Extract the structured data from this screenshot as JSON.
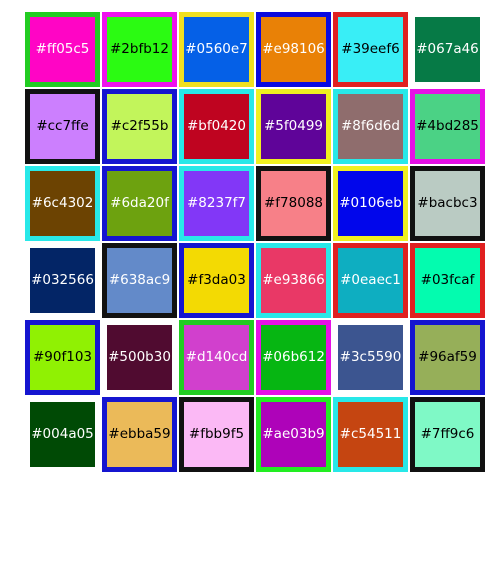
{
  "swatches": [
    {
      "label": "#ff05c5",
      "fill": "#ff05c5",
      "border": "#22cc22",
      "text_color": "#ffffff"
    },
    {
      "label": "#2bfb12",
      "fill": "#2bfb12",
      "border": "#ee11ee",
      "text_color": "#000000"
    },
    {
      "label": "#0560e7",
      "fill": "#0560e7",
      "border": "#f0e020",
      "text_color": "#ffffff"
    },
    {
      "label": "#e98106",
      "fill": "#e98106",
      "border": "#0a0ae0",
      "text_color": "#ffffff"
    },
    {
      "label": "#39eef6",
      "fill": "#39eef6",
      "border": "#e02020",
      "text_color": "#000000"
    },
    {
      "label": "#067a46",
      "fill": "#067a46",
      "border": "#ffffff",
      "text_color": "#ffffff"
    },
    {
      "label": "#cc7ffe",
      "fill": "#cc7ffe",
      "border": "#111111",
      "text_color": "#000000"
    },
    {
      "label": "#c2f55b",
      "fill": "#c2f55b",
      "border": "#1515d0",
      "text_color": "#000000"
    },
    {
      "label": "#bf0420",
      "fill": "#bf0420",
      "border": "#28e8e8",
      "text_color": "#ffffff"
    },
    {
      "label": "#5f0499",
      "fill": "#5f0499",
      "border": "#f0f020",
      "text_color": "#ffffff"
    },
    {
      "label": "#8f6d6d",
      "fill": "#8f6d6d",
      "border": "#28e8e8",
      "text_color": "#ffffff"
    },
    {
      "label": "#4bd285",
      "fill": "#4bd285",
      "border": "#e610e6",
      "text_color": "#000000"
    },
    {
      "label": "#6c4302",
      "fill": "#6c4302",
      "border": "#28e8e8",
      "text_color": "#ffffff"
    },
    {
      "label": "#6da20f",
      "fill": "#6da20f",
      "border": "#1515d0",
      "text_color": "#ffffff"
    },
    {
      "label": "#8237f7",
      "fill": "#8237f7",
      "border": "#28e8e8",
      "text_color": "#ffffff"
    },
    {
      "label": "#f78088",
      "fill": "#f78088",
      "border": "#111111",
      "text_color": "#000000"
    },
    {
      "label": "#0106eb",
      "fill": "#0106eb",
      "border": "#f0f020",
      "text_color": "#ffffff"
    },
    {
      "label": "#bacbc3",
      "fill": "#bacbc3",
      "border": "#111111",
      "text_color": "#000000"
    },
    {
      "label": "#032566",
      "fill": "#032566",
      "border": "#ffffff",
      "text_color": "#ffffff"
    },
    {
      "label": "#638ac9",
      "fill": "#638ac9",
      "border": "#111111",
      "text_color": "#ffffff"
    },
    {
      "label": "#f3da03",
      "fill": "#f3da03",
      "border": "#1515d0",
      "text_color": "#000000"
    },
    {
      "label": "#e93866",
      "fill": "#e93866",
      "border": "#28e8e8",
      "text_color": "#ffffff"
    },
    {
      "label": "#0eaec1",
      "fill": "#0eaec1",
      "border": "#e02020",
      "text_color": "#ffffff"
    },
    {
      "label": "#03fcaf",
      "fill": "#03fcaf",
      "border": "#e02020",
      "text_color": "#000000"
    },
    {
      "label": "#90f103",
      "fill": "#90f103",
      "border": "#1515d0",
      "text_color": "#000000"
    },
    {
      "label": "#500b30",
      "fill": "#500b30",
      "border": "#ffffff",
      "text_color": "#ffffff"
    },
    {
      "label": "#d140cd",
      "fill": "#d140cd",
      "border": "#22cc22",
      "text_color": "#ffffff"
    },
    {
      "label": "#06b612",
      "fill": "#06b612",
      "border": "#e610e6",
      "text_color": "#ffffff"
    },
    {
      "label": "#3c5590",
      "fill": "#3c5590",
      "border": "#ffffff",
      "text_color": "#ffffff"
    },
    {
      "label": "#96af59",
      "fill": "#96af59",
      "border": "#1515d0",
      "text_color": "#000000"
    },
    {
      "label": "#004a05",
      "fill": "#004a05",
      "border": "#ffffff",
      "text_color": "#ffffff"
    },
    {
      "label": "#ebba59",
      "fill": "#ebba59",
      "border": "#1515d0",
      "text_color": "#000000"
    },
    {
      "label": "#fbb9f5",
      "fill": "#fbb9f5",
      "border": "#111111",
      "text_color": "#000000"
    },
    {
      "label": "#ae03b9",
      "fill": "#ae03b9",
      "border": "#22ee22",
      "text_color": "#ffffff"
    },
    {
      "label": "#c54511",
      "fill": "#c54511",
      "border": "#28e8e8",
      "text_color": "#ffffff"
    },
    {
      "label": "#7ff9c6",
      "fill": "#7ff9c6",
      "border": "#111111",
      "text_color": "#000000"
    }
  ]
}
